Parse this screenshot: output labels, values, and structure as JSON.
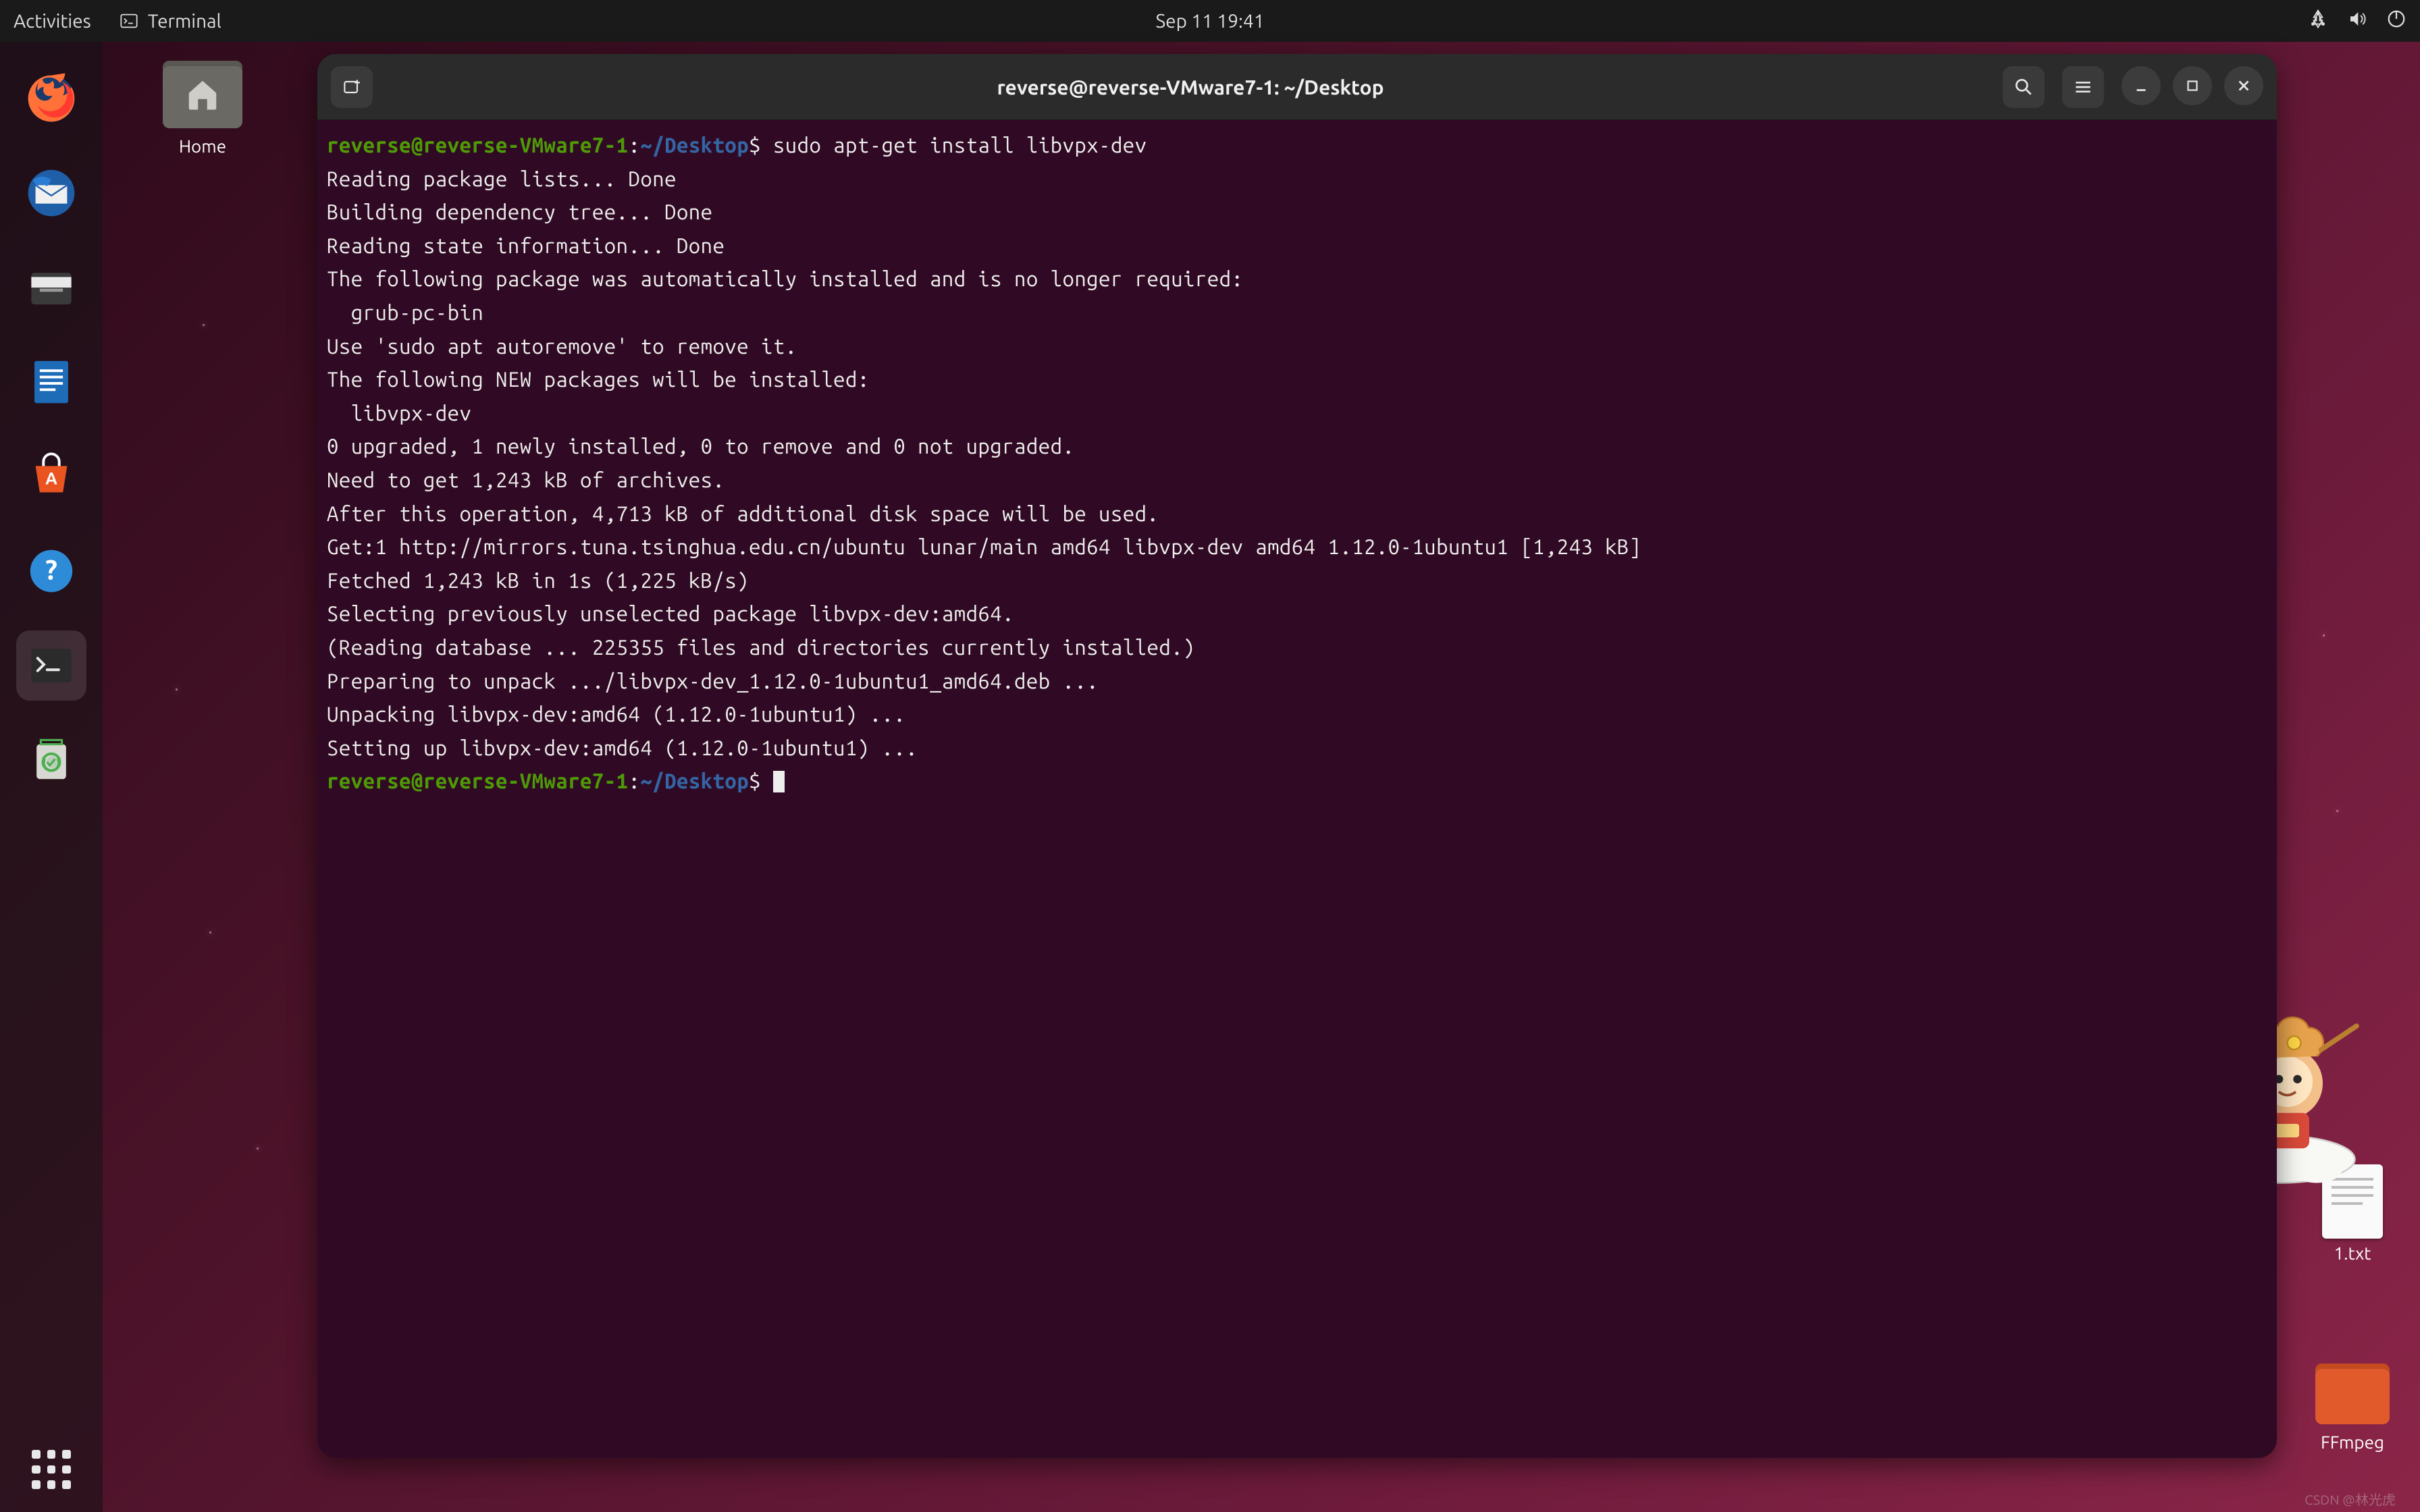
{
  "topbar": {
    "activities": "Activities",
    "app_name": "Terminal",
    "clock": "Sep 11  19:41"
  },
  "desktop_icons": {
    "home": "Home",
    "txt_file": "1.txt",
    "ffmpeg": "FFmpeg"
  },
  "window": {
    "title": "reverse@reverse-VMware7-1: ~/Desktop"
  },
  "terminal": {
    "prompt_user": "reverse@reverse-VMware7-1",
    "prompt_sep": ":",
    "prompt_path": "~/Desktop",
    "prompt_symbol": "$",
    "command1": " sudo apt-get install libvpx-dev",
    "lines": [
      "Reading package lists... Done",
      "Building dependency tree... Done",
      "Reading state information... Done",
      "The following package was automatically installed and is no longer required:",
      "  grub-pc-bin",
      "Use 'sudo apt autoremove' to remove it.",
      "The following NEW packages will be installed:",
      "  libvpx-dev",
      "0 upgraded, 1 newly installed, 0 to remove and 0 not upgraded.",
      "Need to get 1,243 kB of archives.",
      "After this operation, 4,713 kB of additional disk space will be used.",
      "Get:1 http://mirrors.tuna.tsinghua.edu.cn/ubuntu lunar/main amd64 libvpx-dev amd64 1.12.0-1ubuntu1 [1,243 kB]",
      "Fetched 1,243 kB in 1s (1,225 kB/s)",
      "Selecting previously unselected package libvpx-dev:amd64.",
      "(Reading database ... 225355 files and directories currently installed.)",
      "Preparing to unpack .../libvpx-dev_1.12.0-1ubuntu1_amd64.deb ...",
      "Unpacking libvpx-dev:amd64 (1.12.0-1ubuntu1) ...",
      "Setting up libvpx-dev:amd64 (1.12.0-1ubuntu1) ..."
    ]
  },
  "watermark": "CSDN @林光虎"
}
